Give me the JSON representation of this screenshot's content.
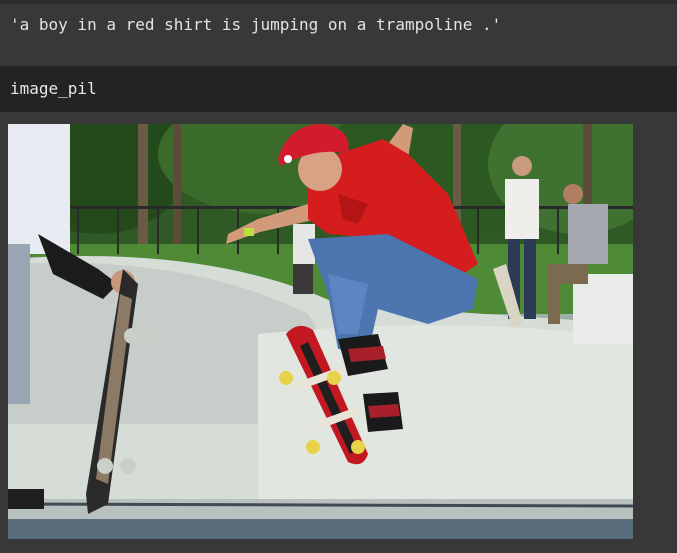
{
  "output": {
    "caption_text": "'a boy in a red shirt is jumping on a trampoline .'"
  },
  "variable": {
    "name": "image_pil"
  },
  "image": {
    "subject": "skateboarder-photo"
  }
}
